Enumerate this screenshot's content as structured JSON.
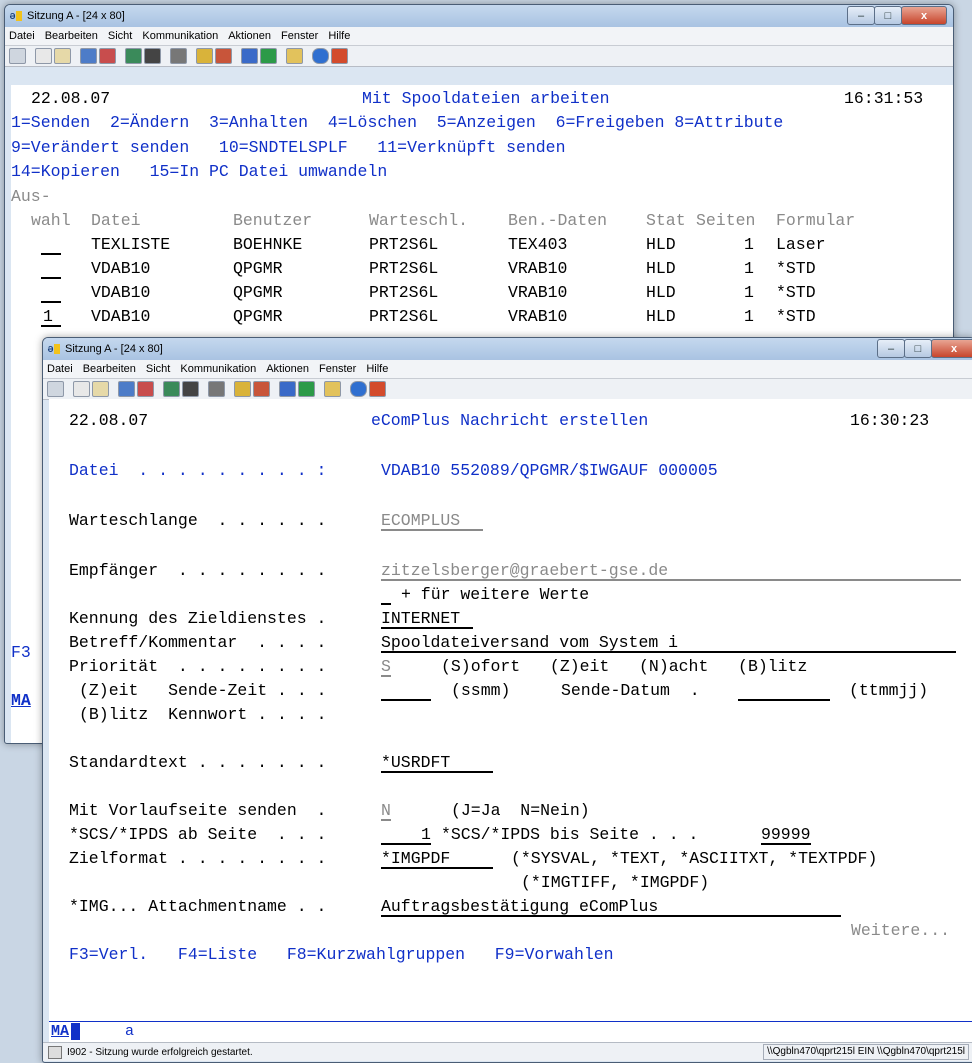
{
  "back": {
    "title": "Sitzung A - [24 x 80]",
    "menu": [
      "Datei",
      "Bearbeiten",
      "Sicht",
      "Kommunikation",
      "Aktionen",
      "Fenster",
      "Hilfe"
    ],
    "date": "22.08.07",
    "heading": "Mit Spooldateien arbeiten",
    "time": "16:31:53",
    "options1": "1=Senden  2=Ändern  3=Anhalten  4=Löschen  5=Anzeigen  6=Freigeben 8=Attribute",
    "options2": "9=Verändert senden   10=SNDTELSPLF   11=Verknüpft senden",
    "options3": "14=Kopieren   15=In PC Datei umwandeln",
    "hdr_aus": "Aus-",
    "hdr_wahl": "wahl",
    "hdr_cols": [
      "Datei",
      "Benutzer",
      "Warteschl.",
      "Ben.-Daten",
      "Stat",
      "Seiten",
      "Formular"
    ],
    "rows": [
      {
        "opt": "",
        "datei": "TEXLISTE",
        "benutzer": "BOEHNKE",
        "warteschl": "PRT2S6L",
        "bendaten": "TEX403",
        "stat": "HLD",
        "seiten": "1",
        "formular": "Laser"
      },
      {
        "opt": "",
        "datei": "VDAB10",
        "benutzer": "QPGMR",
        "warteschl": "PRT2S6L",
        "bendaten": "VRAB10",
        "stat": "HLD",
        "seiten": "1",
        "formular": "*STD"
      },
      {
        "opt": "",
        "datei": "VDAB10",
        "benutzer": "QPGMR",
        "warteschl": "PRT2S6L",
        "bendaten": "VRAB10",
        "stat": "HLD",
        "seiten": "1",
        "formular": "*STD"
      },
      {
        "opt": "1",
        "datei": "VDAB10",
        "benutzer": "QPGMR",
        "warteschl": "PRT2S6L",
        "bendaten": "VRAB10",
        "stat": "HLD",
        "seiten": "1",
        "formular": "*STD"
      }
    ],
    "f3": "F3",
    "ma": "MA"
  },
  "front": {
    "title": "Sitzung A - [24 x 80]",
    "menu": [
      "Datei",
      "Bearbeiten",
      "Sicht",
      "Kommunikation",
      "Aktionen",
      "Fenster",
      "Hilfe"
    ],
    "date": "22.08.07",
    "heading": "eComPlus Nachricht erstellen",
    "time": "16:30:23",
    "datei_label": "Datei  . . . . . . . . . :",
    "datei_value": "VDAB10 552089/QPGMR/$IWGAUF 000005",
    "warteschlange_label": "Warteschlange  . . . . . .",
    "warteschlange_value": "ECOMPLUS",
    "empfaenger_label": "Empfänger  . . . . . . . .",
    "empfaenger_value": "zitzelsberger@graebert-gse.de",
    "weitere_werte": "+ für weitere Werte",
    "kennung_label": "Kennung des Zieldienstes .",
    "kennung_value": "INTERNET",
    "betreff_label": "Betreff/Kommentar  . . . .",
    "betreff_value": "Spooldateiversand vom System i",
    "prioritaet_label": "Priorität  . . . . . . . .",
    "prioritaet_value": "S",
    "prioritaet_opts": "(S)ofort   (Z)eit   (N)acht   (B)litz",
    "zeit_label": "(Z)eit   Sende-Zeit . . .",
    "ssmm": "(ssmm)",
    "sende_datum": "Sende-Datum  .",
    "ttmmjj": "(ttmmjj)",
    "blitz_label": "(B)litz  Kennwort . . . .",
    "standardtext_label": "Standardtext . . . . . . .",
    "standardtext_value": "*USRDFT",
    "vorlauf_label": "Mit Vorlaufseite senden  .",
    "vorlauf_value": "N",
    "vorlauf_hint": "(J=Ja  N=Nein)",
    "scs_label": "*SCS/*IPDS ab Seite  . . .",
    "scs_value": "1",
    "scs_bis_label": "*SCS/*IPDS bis Seite . . .",
    "scs_bis_value": "99999",
    "zielformat_label": "Zielformat . . . . . . . .",
    "zielformat_value": "*IMGPDF",
    "zielformat_hint1": "(*SYSVAL, *TEXT, *ASCIITXT, *TEXTPDF)",
    "zielformat_hint2": "(*IMGTIFF, *IMGPDF)",
    "attach_label": "*IMG... Attachmentname . .",
    "attach_value": "Auftragsbestätigung eComPlus",
    "weitere": "Weitere...",
    "fkeys": "F3=Verl.   F4=Liste   F8=Kurzwahlgruppen   F9=Vorwahlen",
    "ma": "MA",
    "input_char": "a",
    "status_msg": "I902 - Sitzung wurde erfolgreich gestartet.",
    "status_right": "\\\\Qgbln470\\qprt215l EIN \\\\Qgbln470\\qprt215l"
  }
}
